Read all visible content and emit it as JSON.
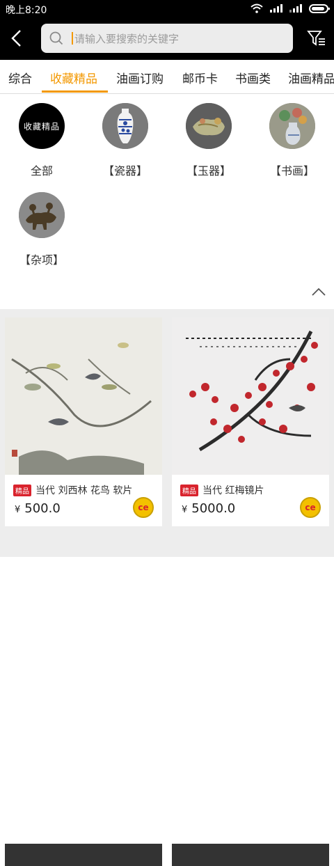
{
  "status": {
    "time": "晚上8:20"
  },
  "search": {
    "placeholder": "请输入要搜索的关键字"
  },
  "tabs": [
    {
      "label": "综合"
    },
    {
      "label": "收藏精品",
      "active": true
    },
    {
      "label": "油画订购"
    },
    {
      "label": "邮币卡"
    },
    {
      "label": "书画类"
    },
    {
      "label": "油画精品"
    }
  ],
  "categories": [
    {
      "label": "全部",
      "badge": "收藏精品",
      "icon": "collection-badge-icon"
    },
    {
      "label": "【瓷器】",
      "icon": "porcelain-vase-icon"
    },
    {
      "label": "【玉器】",
      "icon": "jade-carving-icon"
    },
    {
      "label": "【书画】",
      "icon": "painting-vase-icon"
    },
    {
      "label": "【杂项】",
      "icon": "bronze-sculpture-icon"
    }
  ],
  "products": [
    {
      "badge": "精品",
      "title": "当代 刘西林 花鸟 软片",
      "price": "500.0",
      "currency": "¥"
    },
    {
      "badge": "精品",
      "title": "当代 红梅镜片",
      "price": "5000.0",
      "currency": "¥"
    }
  ],
  "colors": {
    "accent": "#f39800",
    "badge": "#d9232d"
  }
}
